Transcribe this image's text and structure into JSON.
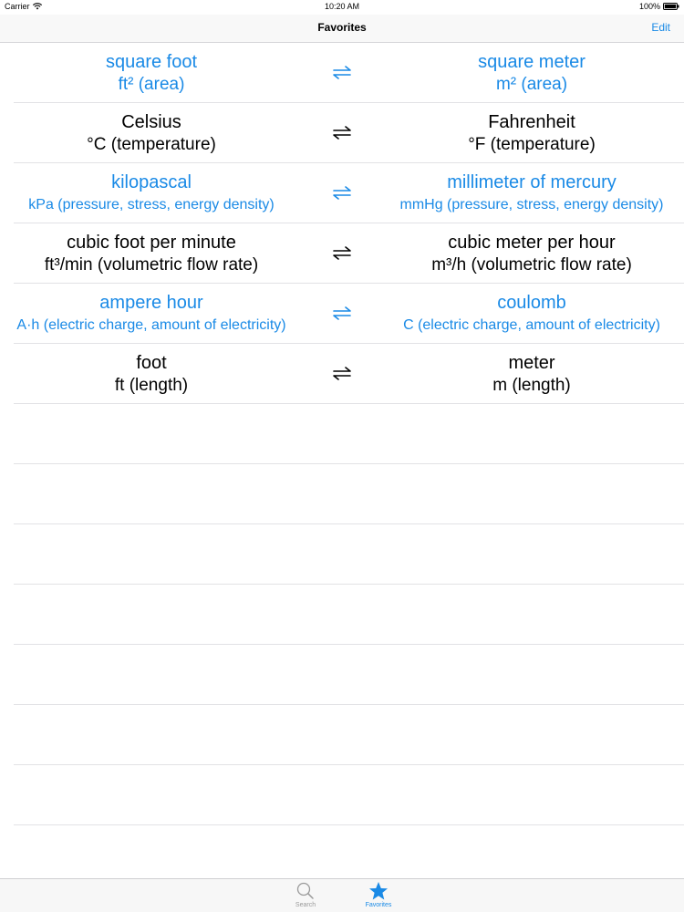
{
  "status_bar": {
    "carrier": "Carrier",
    "time": "10:20 AM",
    "battery": "100%"
  },
  "nav": {
    "title": "Favorites",
    "edit_label": "Edit"
  },
  "favorites": [
    {
      "color": "blue",
      "left_name": "square foot",
      "left_desc": "ft² (area)",
      "right_name": "square meter",
      "right_desc": "m² (area)"
    },
    {
      "color": "black",
      "left_name": "Celsius",
      "left_desc": "°C (temperature)",
      "right_name": "Fahrenheit",
      "right_desc": "°F (temperature)"
    },
    {
      "color": "blue",
      "left_name": "kilopascal",
      "left_desc": "kPa (pressure, stress, energy density)",
      "right_name": "millimeter of mercury",
      "right_desc": "mmHg (pressure, stress, energy density)"
    },
    {
      "color": "black",
      "left_name": "cubic foot per minute",
      "left_desc": "ft³/min (volumetric flow rate)",
      "right_name": "cubic meter per hour",
      "right_desc": "m³/h (volumetric flow rate)"
    },
    {
      "color": "blue",
      "left_name": "ampere hour",
      "left_desc": "A·h (electric charge, amount of electricity)",
      "right_name": "coulomb",
      "right_desc": "C (electric charge, amount of electricity)"
    },
    {
      "color": "black",
      "left_name": "foot",
      "left_desc": "ft (length)",
      "right_name": "meter",
      "right_desc": "m (length)"
    }
  ],
  "tab_bar": {
    "search_label": "Search",
    "favorites_label": "Favorites"
  },
  "colors": {
    "accent": "#1a8ae6"
  }
}
